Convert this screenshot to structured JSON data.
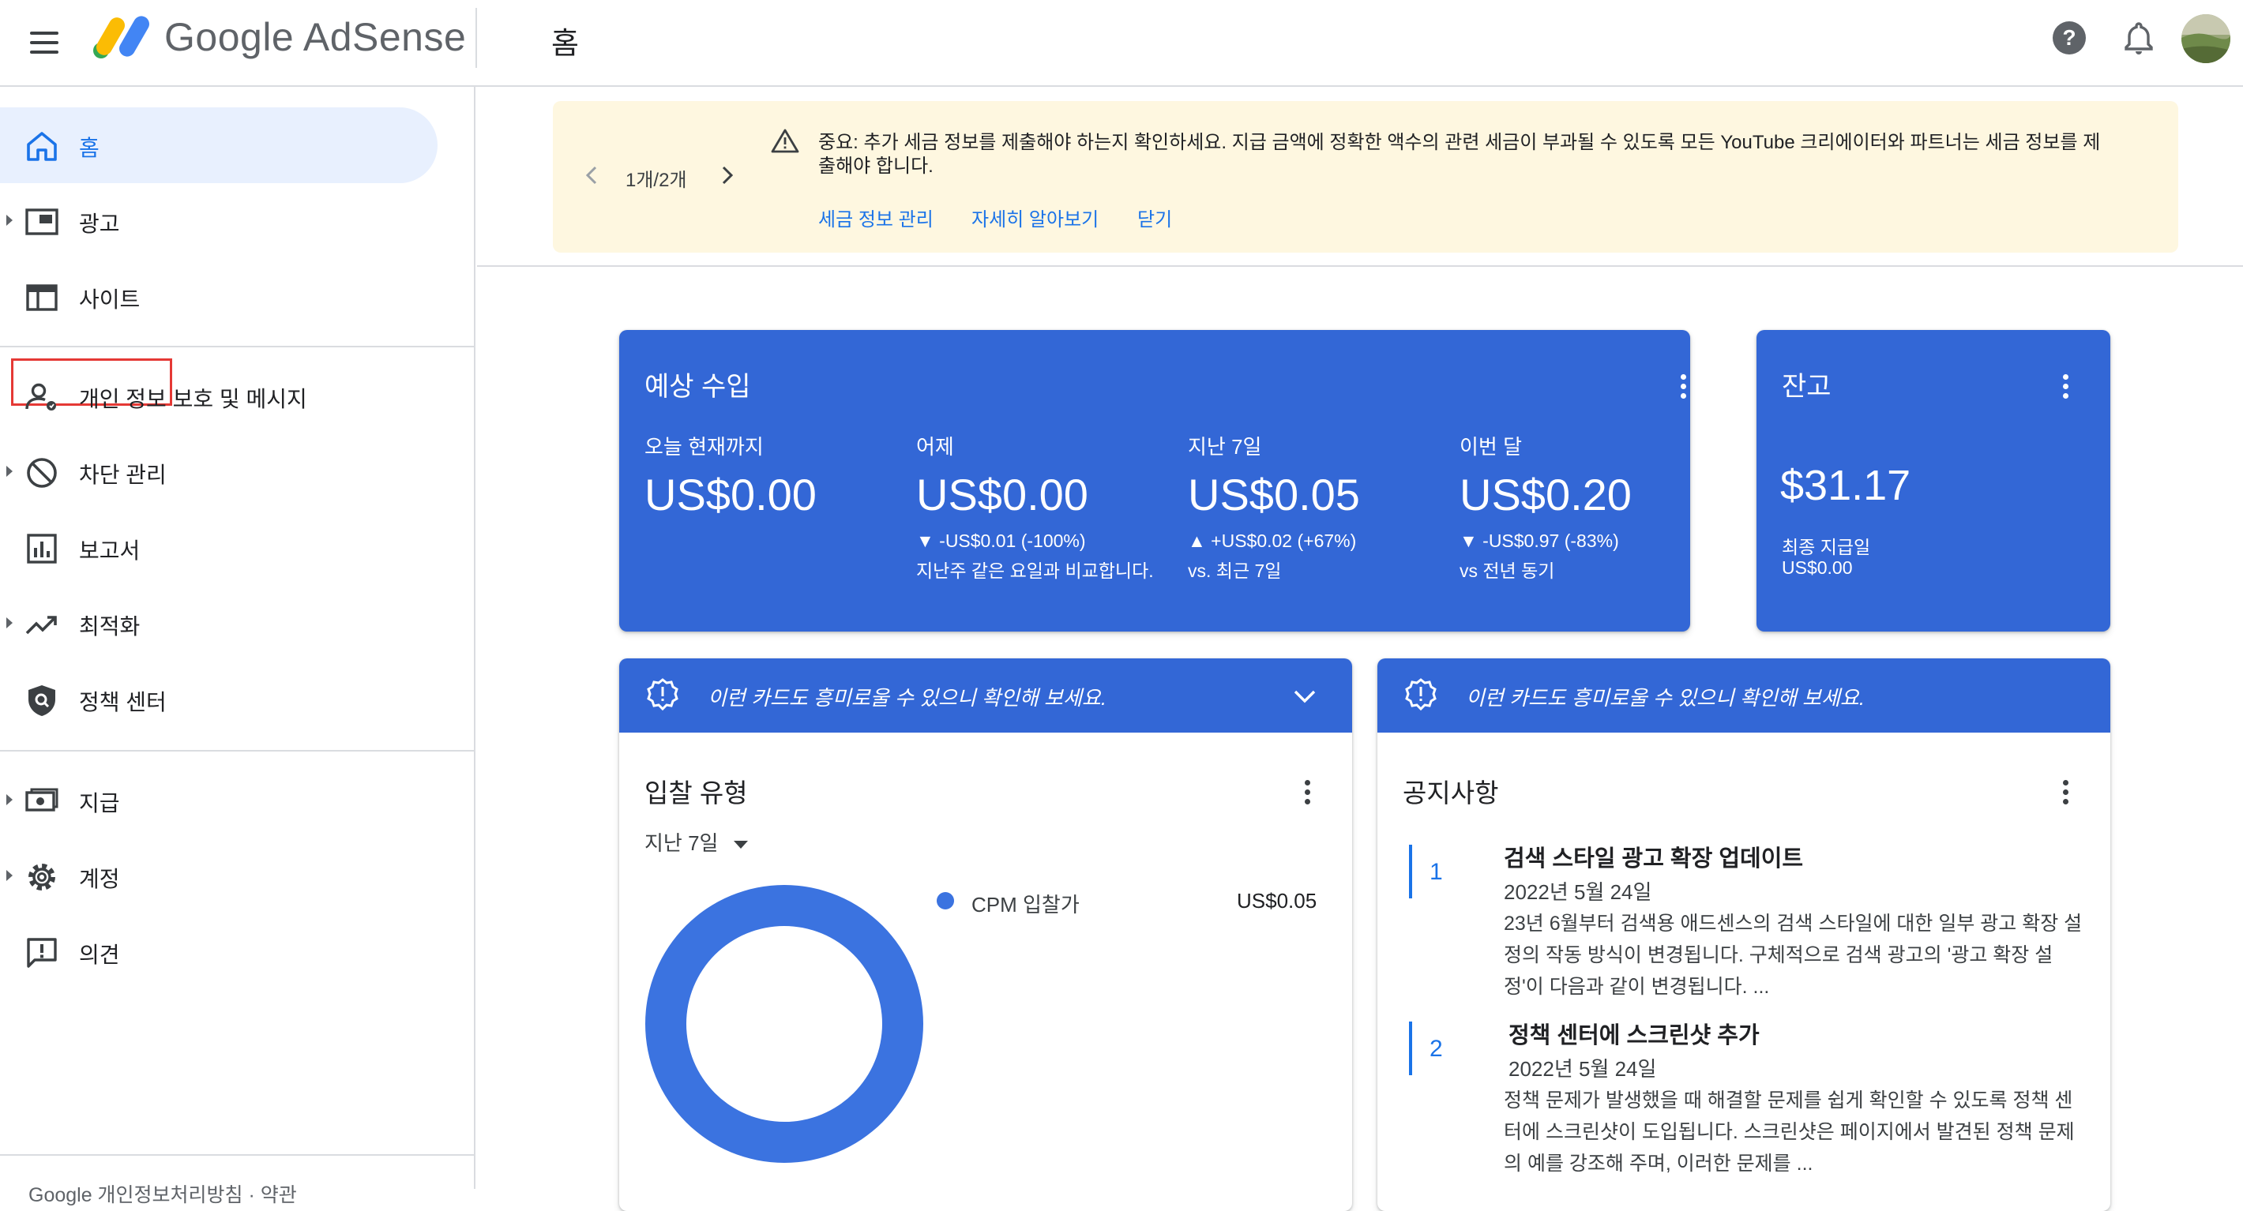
{
  "header": {
    "brand": "Google AdSense",
    "page_title": "홈",
    "icons": [
      "menu-icon",
      "help-icon",
      "bell-icon",
      "avatar"
    ]
  },
  "sidebar": {
    "items": [
      {
        "label": "홈",
        "icon": "home-icon",
        "active": true
      },
      {
        "label": "광고",
        "icon": "ads-icon"
      },
      {
        "label": "사이트",
        "icon": "sites-icon",
        "highlighted": true
      },
      {
        "label": "개인 정보 보호 및 메시지",
        "icon": "privacy-icon"
      },
      {
        "label": "차단 관리",
        "icon": "block-icon"
      },
      {
        "label": "보고서",
        "icon": "reports-icon"
      },
      {
        "label": "최적화",
        "icon": "optimize-icon"
      },
      {
        "label": "정책 센터",
        "icon": "policy-icon"
      },
      {
        "label": "지급",
        "icon": "payments-icon"
      },
      {
        "label": "계정",
        "icon": "settings-icon"
      },
      {
        "label": "의견",
        "icon": "feedback-icon"
      }
    ],
    "footer_text": "Google 개인정보처리방침 · 약관"
  },
  "banner": {
    "pager": "1개/2개",
    "message_line1": "중요: 추가 세금 정보를 제출해야 하는지 확인하세요. 지급 금액에 정확한 액수의 관련 세금이 부과될 수 있도록 모든 YouTube 크리에이터와 파트너는 세금 정보를 제",
    "message_line2": "출해야 합니다.",
    "links": [
      "세금 정보 관리",
      "자세히 알아보기",
      "닫기"
    ]
  },
  "earnings": {
    "title": "예상 수입",
    "stats": [
      {
        "label": "오늘 현재까지",
        "value": "US$0.00",
        "delta": "",
        "compare": ""
      },
      {
        "label": "어제",
        "value": "US$0.00",
        "delta": "▼ -US$0.01 (-100%)",
        "compare": "지난주 같은 요일과 비교합니다."
      },
      {
        "label": "지난 7일",
        "value": "US$0.05",
        "delta": "▲ +US$0.02 (+67%)",
        "compare": "vs. 최근 7일"
      },
      {
        "label": "이번 달",
        "value": "US$0.20",
        "delta": "▼ -US$0.97 (-83%)",
        "compare": "vs 전년 동기"
      }
    ]
  },
  "balance": {
    "title": "잔고",
    "value": "$31.17",
    "last_payment_label": "최종 지급일",
    "last_payment_value": "US$0.00"
  },
  "tip_text": "이런 카드도 흥미로울 수 있으니 확인해 보세요.",
  "bid_card": {
    "title": "입찰 유형",
    "range": "지난 7일",
    "legend": [
      {
        "label": "CPM 입찰가",
        "value": "US$0.05",
        "color": "#3b73e0"
      }
    ]
  },
  "chart_data": {
    "type": "pie",
    "categories": [
      "CPM 입찰가"
    ],
    "values": [
      0.05
    ],
    "title": "입찰 유형"
  },
  "notices": {
    "title": "공지사항",
    "items": [
      {
        "num": "1",
        "title": "검색 스타일 광고 확장 업데이트",
        "date": "2022년 5월 24일",
        "body": "23년 6월부터 검색용 애드센스의 검색 스타일에 대한 일부 광고 확장 설정의 작동 방식이 변경됩니다. 구체적으로 검색 광고의 '광고 확장 설정'이 다음과 같이 변경됩니다. ..."
      },
      {
        "num": "2",
        "title": "정책 센터에 스크린샷 추가",
        "date": "2022년 5월 24일",
        "body": "정책 문제가 발생했을 때 해결할 문제를 쉽게 확인할 수 있도록 정책 센터에 스크린샷이 도입됩니다. 스크린샷은 페이지에서 발견된 정책 문제의 예를 강조해 주며, 이러한 문제를 ..."
      }
    ]
  },
  "colors": {
    "accent": "#1a73e8",
    "card_blue": "#3367d6",
    "banner_bg": "#fef7e0",
    "highlight_box": "#e53935"
  }
}
